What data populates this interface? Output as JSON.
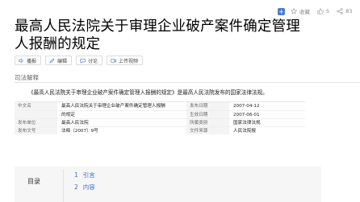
{
  "header": {
    "favorite_label": "收藏",
    "likes_count": "5",
    "shares_count": "83",
    "title": "最高人民法院关于审理企业破产案件确定管理人报酬的规定"
  },
  "actions": {
    "play": "播报",
    "edit": "编辑",
    "discuss": "讨论",
    "upload_video": "上传视频"
  },
  "section": {
    "heading": "司法解释",
    "lead": "《最高人民法院关于审理企业破产案件确定管理人报酬的规定》是最高人民法院发布的国家法律法规。"
  },
  "info_table": {
    "rows": [
      {
        "label": "中文名",
        "value": "最高人民法院关于审理企业破产案件确定管理人报酬",
        "label2": "发布日期",
        "value2": "2007-04-12"
      },
      {
        "label": "",
        "value": "的规定",
        "label2": "生效日期",
        "value2": "2007-06-01"
      },
      {
        "label": "发布单位",
        "value": "最高人民法院",
        "label2": "所属类别",
        "value2": "国家法律法规"
      },
      {
        "label": "发布文号",
        "value": "法释〔2007〕9号",
        "label2": "文件来源",
        "value2": "人民法院报"
      }
    ]
  },
  "toc": {
    "title": "目录",
    "items": [
      {
        "num": "1",
        "label": "引言"
      },
      {
        "num": "2",
        "label": "内容"
      }
    ]
  },
  "colors": {
    "link": "#3b6fc8",
    "accent": "#4a7bd4"
  }
}
